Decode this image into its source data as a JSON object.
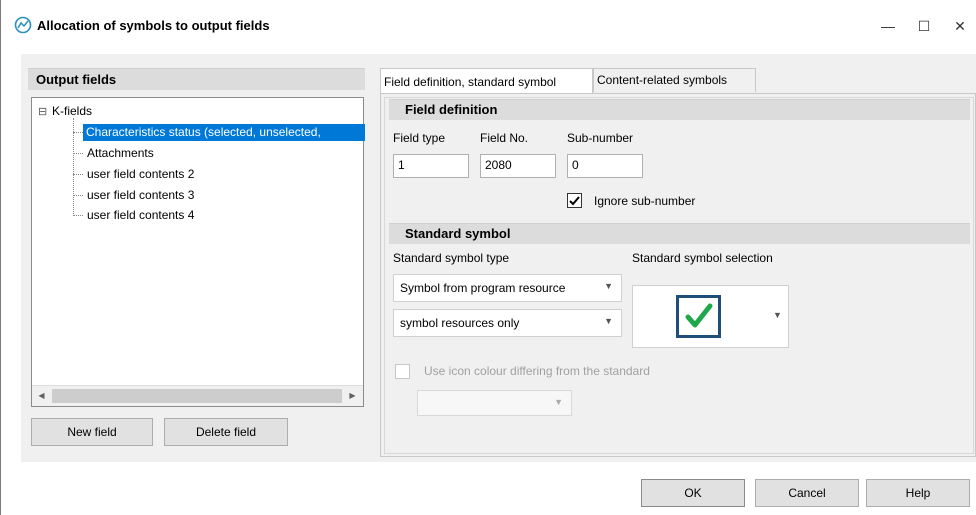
{
  "window": {
    "title": "Allocation of symbols to output fields",
    "minimize": "—",
    "maximize": "☐",
    "close": "✕"
  },
  "left_panel": {
    "header": "Output fields",
    "tree": {
      "root": "K-fields",
      "expander": "⊟",
      "items": [
        {
          "label": "Characteristics status (selected, unselected,",
          "selected": true
        },
        {
          "label": "Attachments",
          "selected": false
        },
        {
          "label": "user field contents 2",
          "selected": false
        },
        {
          "label": "user field contents 3",
          "selected": false
        },
        {
          "label": "user field contents 4",
          "selected": false
        }
      ]
    },
    "scroll_left": "◀",
    "scroll_right": "▶",
    "new_field": "New field",
    "delete_field": "Delete field"
  },
  "tabs": [
    {
      "label": "Field definition, standard symbol",
      "active": true
    },
    {
      "label": "Content-related symbols",
      "active": false
    }
  ],
  "field_definition": {
    "header": "Field definition",
    "field_type_label": "Field type",
    "field_type_value": "1",
    "field_no_label": "Field No.",
    "field_no_value": "2080",
    "sub_number_label": "Sub-number",
    "sub_number_value": "0",
    "ignore_sub_number_label": "Ignore sub-number",
    "ignore_sub_number_checked": true
  },
  "standard_symbol": {
    "header": "Standard symbol",
    "type_label": "Standard symbol type",
    "selection_label": "Standard symbol selection",
    "type_combo_value": "Symbol from program resource",
    "resource_combo_value": "symbol resources only",
    "use_icon_colour_label": "Use icon colour differing from the standard",
    "use_icon_colour_checked": false,
    "colour_combo_value": "",
    "symbol_color": "#1fa84b",
    "symbol_border_color": "#1f4e79"
  },
  "footer": {
    "ok": "OK",
    "cancel": "Cancel",
    "help": "Help"
  }
}
